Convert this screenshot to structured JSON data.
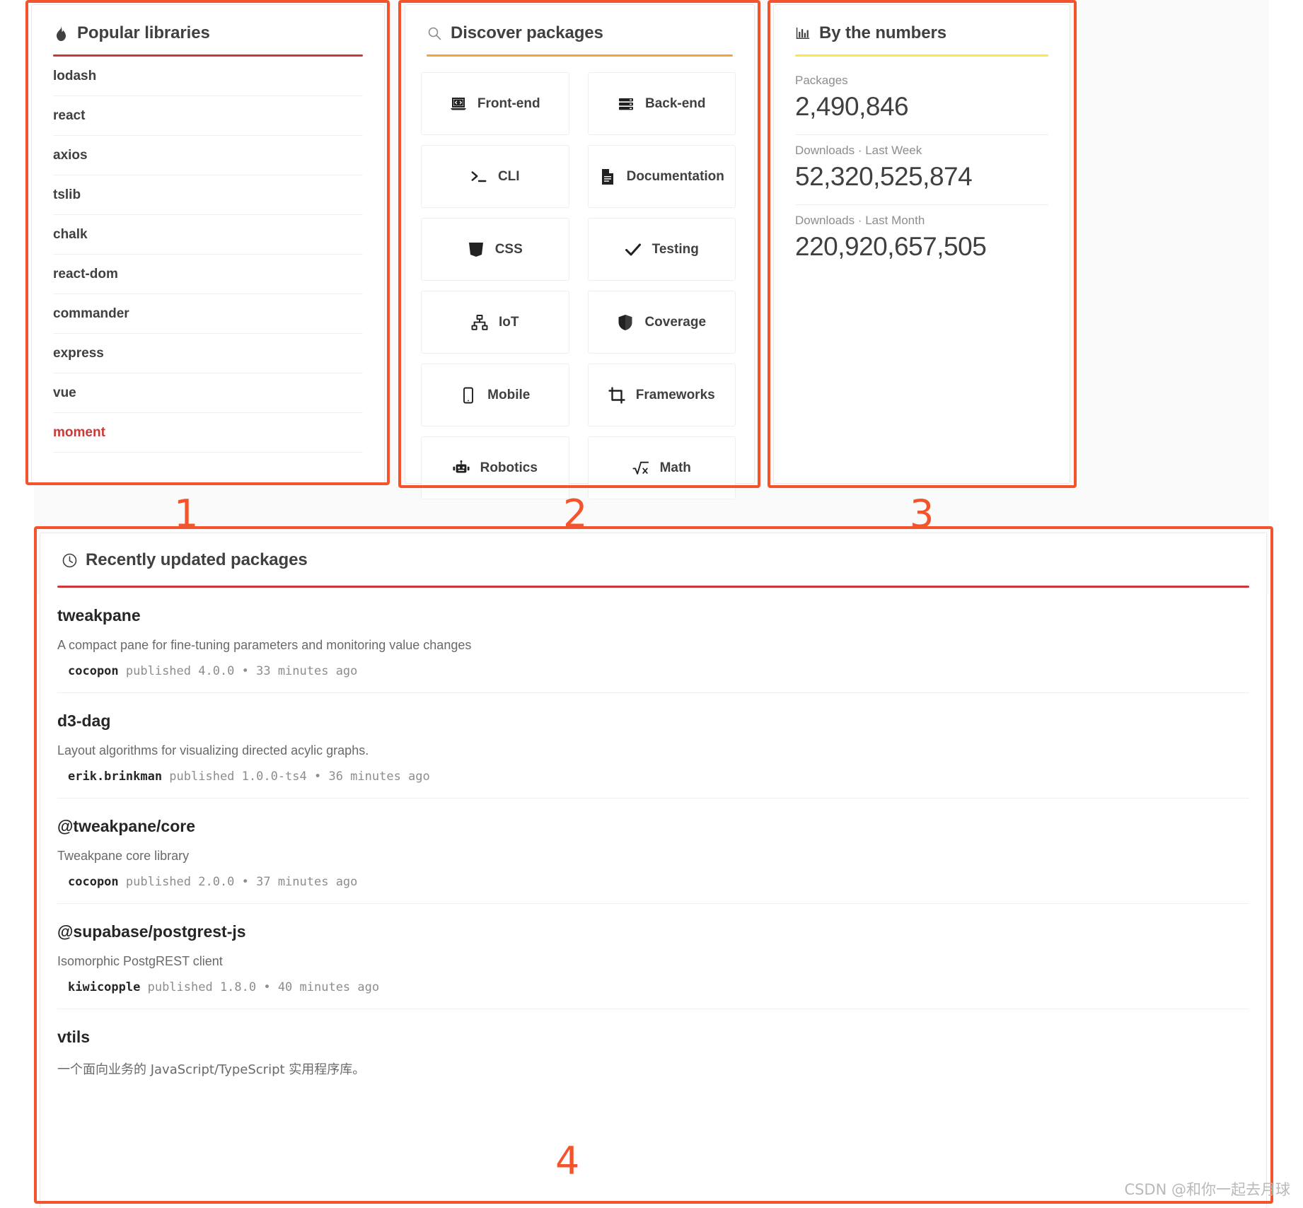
{
  "popular": {
    "title": "Popular libraries",
    "icon": "fire-icon",
    "rule_color": "#cb3837",
    "items": [
      {
        "name": "lodash",
        "accent": false
      },
      {
        "name": "react",
        "accent": false
      },
      {
        "name": "axios",
        "accent": false
      },
      {
        "name": "tslib",
        "accent": false
      },
      {
        "name": "chalk",
        "accent": false
      },
      {
        "name": "react-dom",
        "accent": false
      },
      {
        "name": "commander",
        "accent": false
      },
      {
        "name": "express",
        "accent": false
      },
      {
        "name": "vue",
        "accent": false
      },
      {
        "name": "moment",
        "accent": true
      }
    ]
  },
  "discover": {
    "title": "Discover packages",
    "icon": "search-icon",
    "rule_color": "#f2a33c",
    "categories": [
      {
        "label": "Front-end",
        "icon": "laptop-code-icon"
      },
      {
        "label": "Back-end",
        "icon": "server-icon"
      },
      {
        "label": "CLI",
        "icon": "terminal-icon"
      },
      {
        "label": "Documentation",
        "icon": "document-icon"
      },
      {
        "label": "CSS",
        "icon": "css3-icon"
      },
      {
        "label": "Testing",
        "icon": "check-icon"
      },
      {
        "label": "IoT",
        "icon": "network-icon"
      },
      {
        "label": "Coverage",
        "icon": "shield-icon"
      },
      {
        "label": "Mobile",
        "icon": "mobile-icon"
      },
      {
        "label": "Frameworks",
        "icon": "crop-icon"
      },
      {
        "label": "Robotics",
        "icon": "robot-icon"
      },
      {
        "label": "Math",
        "icon": "square-root-icon"
      }
    ]
  },
  "numbers": {
    "title": "By the numbers",
    "icon": "bar-chart-icon",
    "rule_color": "#fbe846",
    "stats": [
      {
        "label": "Packages",
        "value": "2,490,846"
      },
      {
        "label": "Downloads · Last Week",
        "value": "52,320,525,874"
      },
      {
        "label": "Downloads · Last Month",
        "value": "220,920,657,505"
      }
    ]
  },
  "recent": {
    "title": "Recently updated packages",
    "icon": "clock-icon",
    "rule_color": "#cb3837",
    "packages": [
      {
        "name": "tweakpane",
        "description": "A compact pane for fine-tuning parameters and monitoring value changes",
        "author": "cocopon",
        "meta": "published 4.0.0 • 33 minutes ago"
      },
      {
        "name": "d3-dag",
        "description": "Layout algorithms for visualizing directed acylic graphs.",
        "author": "erik.brinkman",
        "meta": "published 1.0.0-ts4 • 36 minutes ago"
      },
      {
        "name": "@tweakpane/core",
        "description": "Tweakpane core library",
        "author": "cocopon",
        "meta": "published 2.0.0 • 37 minutes ago"
      },
      {
        "name": "@supabase/postgrest-js",
        "description": "Isomorphic PostgREST client",
        "author": "kiwicopple",
        "meta": "published 1.8.0 • 40 minutes ago"
      },
      {
        "name": "vtils",
        "description": "一个面向业务的 JavaScript/TypeScript 实用程序库。",
        "author": "",
        "meta": ""
      }
    ]
  },
  "annotations": [
    {
      "number": "1"
    },
    {
      "number": "2"
    },
    {
      "number": "3"
    },
    {
      "number": "4"
    }
  ],
  "watermark": "CSDN @和你一起去月球",
  "colors": {
    "callout": "#f4542c",
    "accent_red": "#cb3837",
    "orange": "#f2a33c",
    "yellow": "#fbe846"
  }
}
